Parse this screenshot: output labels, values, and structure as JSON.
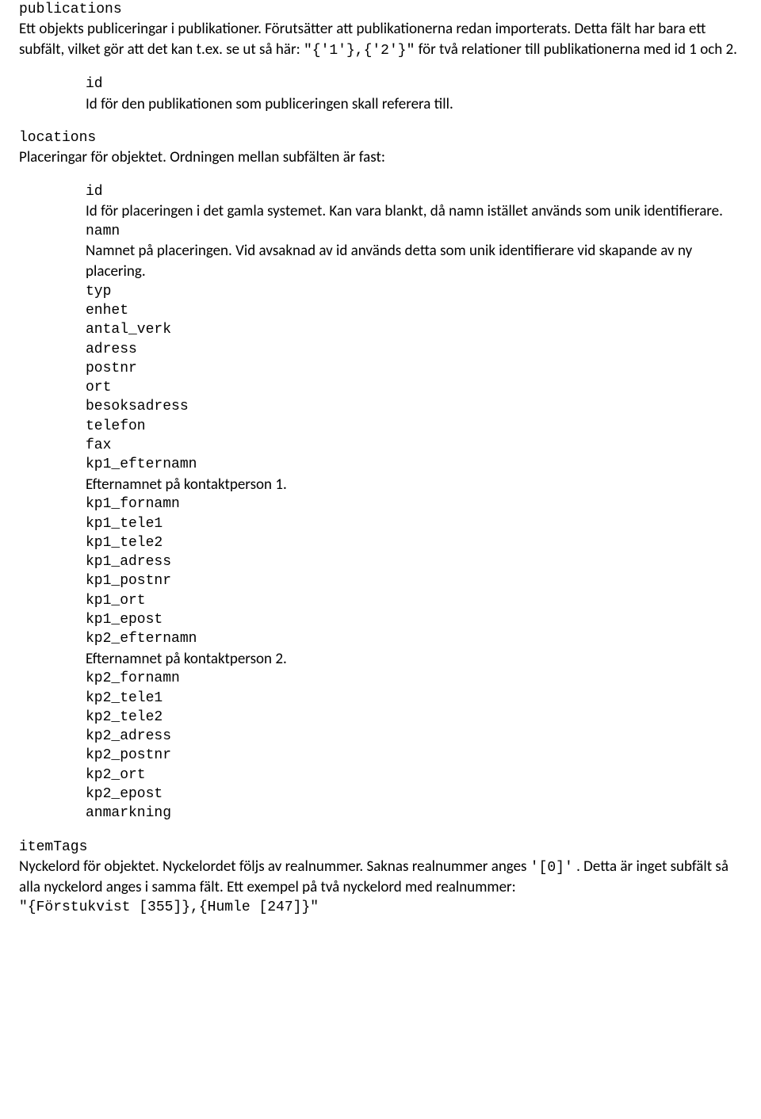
{
  "publications": {
    "heading": "publications",
    "desc1": "Ett objekts publiceringar i publikationer. Förutsätter att publikationerna redan importerats. Detta fält har bara ett subfält, vilket gör att det kan t.ex. se ut så här: ",
    "desc_code": "\"{'1'},{'2'}\"",
    "desc2": "  för två relationer till publikationerna med id 1 och 2.",
    "sub": {
      "id_label": "id",
      "id_desc": "Id för den publikationen som publiceringen skall referera till."
    }
  },
  "locations": {
    "heading": "locations",
    "desc": "Placeringar för objektet. Ordningen mellan subfälten är fast:",
    "sub": {
      "id_label": "id",
      "id_desc": "Id för placeringen i det gamla systemet. Kan vara blankt, då namn istället används som unik identifierare.",
      "namn_label": "namn",
      "namn_desc": "Namnet på placeringen. Vid avsaknad av id används detta som unik identifierare vid skapande av ny placering.",
      "typ": "typ",
      "enhet": "enhet",
      "antal_verk": "antal_verk",
      "adress": "adress",
      "postnr": "postnr",
      "ort": "ort",
      "besoksadress": "besoksadress",
      "telefon": "telefon",
      "fax": "fax",
      "kp1_efternamn": "kp1_efternamn",
      "kp1_efternamn_desc": "Efternamnet på kontaktperson 1.",
      "kp1_fornamn": "kp1_fornamn",
      "kp1_tele1": "kp1_tele1",
      "kp1_tele2": "kp1_tele2",
      "kp1_adress": "kp1_adress",
      "kp1_postnr": "kp1_postnr",
      "kp1_ort": "kp1_ort",
      "kp1_epost": "kp1_epost",
      "kp2_efternamn": "kp2_efternamn",
      "kp2_efternamn_desc": "Efternamnet på kontaktperson 2.",
      "kp2_fornamn": "kp2_fornamn",
      "kp2_tele1": "kp2_tele1",
      "kp2_tele2": "kp2_tele2",
      "kp2_adress": "kp2_adress",
      "kp2_postnr": "kp2_postnr",
      "kp2_ort": "kp2_ort",
      "kp2_epost": "kp2_epost",
      "anmarkning": "anmarkning"
    }
  },
  "itemTags": {
    "heading": "itemTags",
    "desc_a": "Nyckelord för objektet. Nyckelordet följs av realnummer. Saknas realnummer anges ",
    "desc_code1": "'[0]'",
    "desc_b": ". Detta är inget subfält så alla nyckelord anges i samma fält. Ett exempel på två nyckelord med realnummer:",
    "example": "\"{Förstukvist [355]},{Humle [247]}\""
  }
}
